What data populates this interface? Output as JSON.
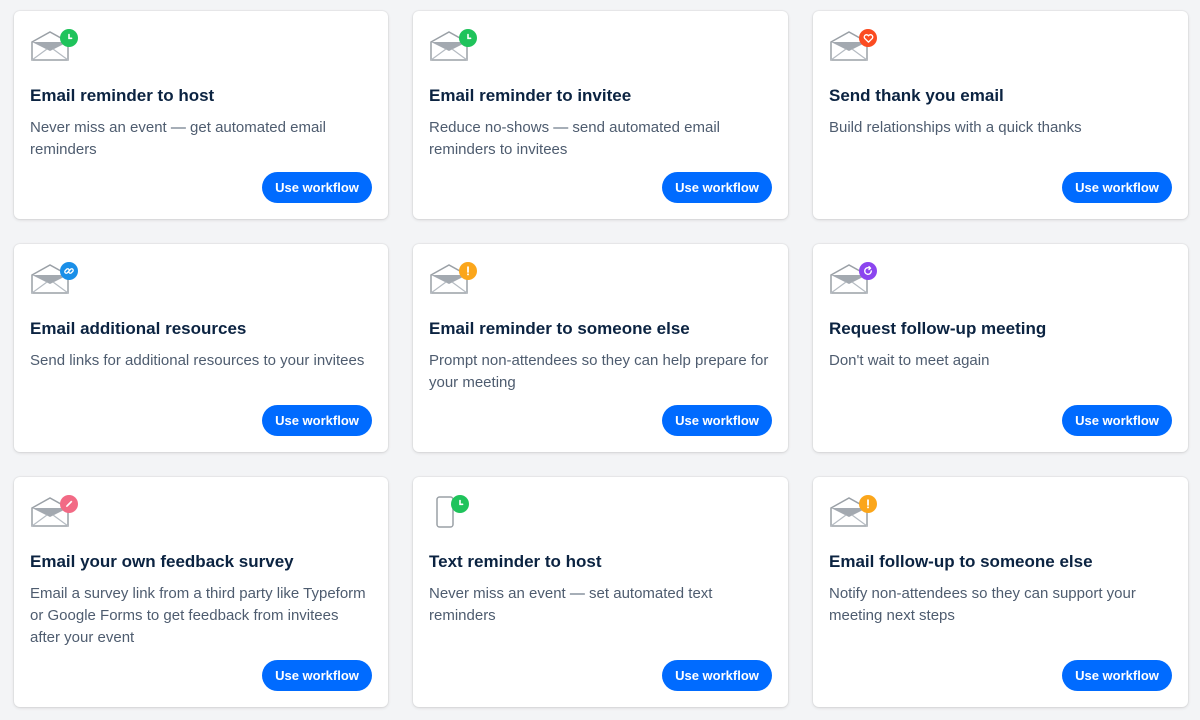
{
  "colors": {
    "primary": "#006bff",
    "title": "#0b2341",
    "description": "#4e5c6f",
    "badge_green": "#1fc35b",
    "badge_red": "#fb4b21",
    "badge_blue": "#1a8fe8",
    "badge_amber": "#fba61b",
    "badge_purple": "#8b45ef",
    "badge_pink": "#f26a85"
  },
  "cards": [
    {
      "title": "Email reminder to host",
      "description": "Never miss an event — get automated email reminders",
      "button": "Use workflow",
      "icon": "envelope-icon",
      "badge_icon": "clock-icon"
    },
    {
      "title": "Email reminder to invitee",
      "description": "Reduce no-shows — send automated email reminders to invitees",
      "button": "Use workflow",
      "icon": "envelope-icon",
      "badge_icon": "clock-icon"
    },
    {
      "title": "Send thank you email",
      "description": "Build relationships with a quick thanks",
      "button": "Use workflow",
      "icon": "envelope-icon",
      "badge_icon": "heart-icon"
    },
    {
      "title": "Email additional resources",
      "description": "Send links for additional resources to your invitees",
      "button": "Use workflow",
      "icon": "envelope-icon",
      "badge_icon": "link-icon"
    },
    {
      "title": "Email reminder to someone else",
      "description": "Prompt non-attendees so they can help prepare for your meeting",
      "button": "Use workflow",
      "icon": "envelope-icon",
      "badge_icon": "exclamation-icon"
    },
    {
      "title": "Request follow-up meeting",
      "description": "Don't wait to meet again",
      "button": "Use workflow",
      "icon": "envelope-icon",
      "badge_icon": "refresh-icon"
    },
    {
      "title": "Email your own feedback survey",
      "description": "Email a survey link from a third party like Typeform or Google Forms to get feedback from invitees after your event",
      "button": "Use workflow",
      "icon": "envelope-icon",
      "badge_icon": "pencil-icon"
    },
    {
      "title": "Text reminder to host",
      "description": "Never miss an event — set automated text reminders",
      "button": "Use workflow",
      "icon": "phone-icon",
      "badge_icon": "clock-icon"
    },
    {
      "title": "Email follow-up to someone else",
      "description": "Notify non-attendees so they can support your meeting next steps",
      "button": "Use workflow",
      "icon": "envelope-icon",
      "badge_icon": "exclamation-icon"
    }
  ]
}
